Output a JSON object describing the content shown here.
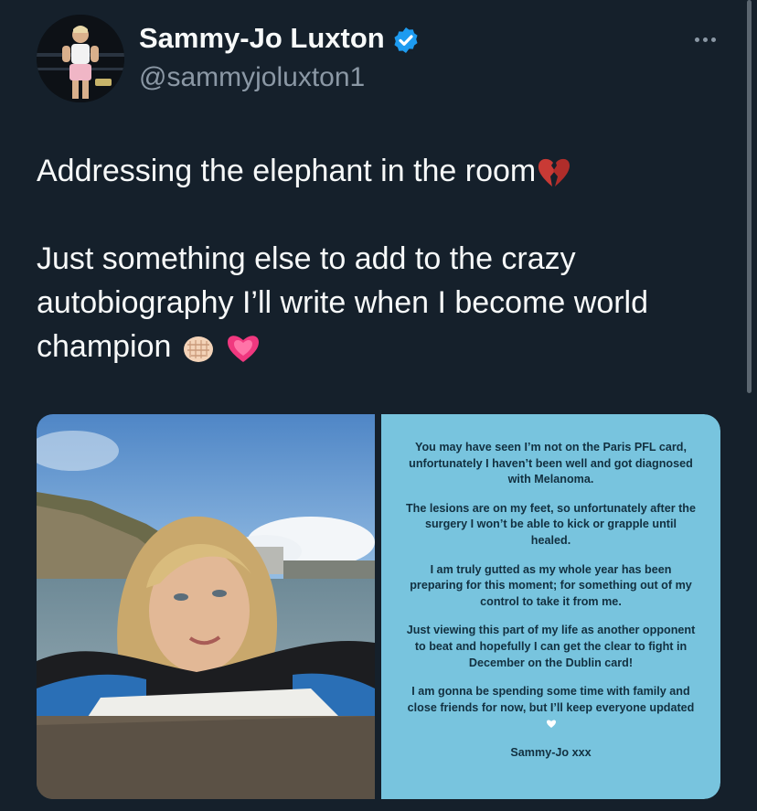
{
  "author": {
    "display_name": "Sammy-Jo Luxton",
    "handle": "@sammyjoluxton1",
    "verified": true,
    "avatar": "fighter-avatar"
  },
  "icons": {
    "verified": "verified-badge-icon",
    "more": "more-options-icon",
    "broken_heart": "broken-heart-emoji",
    "fist": "oncoming-fist-emoji",
    "heart": "growing-heart-emoji",
    "white_heart": "white-heart-emoji"
  },
  "tweet": {
    "line1": "Addressing the elephant in the room",
    "line2": "Just something else to add to the crazy autobiography I’ll write when I become world champion"
  },
  "media": {
    "photo": "selfie-photo-at-sea",
    "statement": {
      "p1": "You may have seen I’m not on the Paris PFL card, unfortunately I haven’t been well and got diagnosed with Melanoma.",
      "p2": "The lesions are on my feet, so unfortunately after the surgery I won’t be able to kick or grapple until healed.",
      "p3": "I am truly gutted as my whole year has been preparing for this moment; for something out of my control to take it from me.",
      "p4": "Just viewing this part of my life as another opponent to beat and hopefully I can get the clear to fight in December on the Dublin card!",
      "p5": "I am gonna be spending some time with family and close friends for now, but I’ll keep everyone updated",
      "signoff": "Sammy-Jo xxx"
    }
  },
  "colors": {
    "background": "#15202b",
    "text": "#f7f9f9",
    "muted": "#8b98a5",
    "verified": "#1d9bf0",
    "statement_bg": "#78c4de"
  }
}
